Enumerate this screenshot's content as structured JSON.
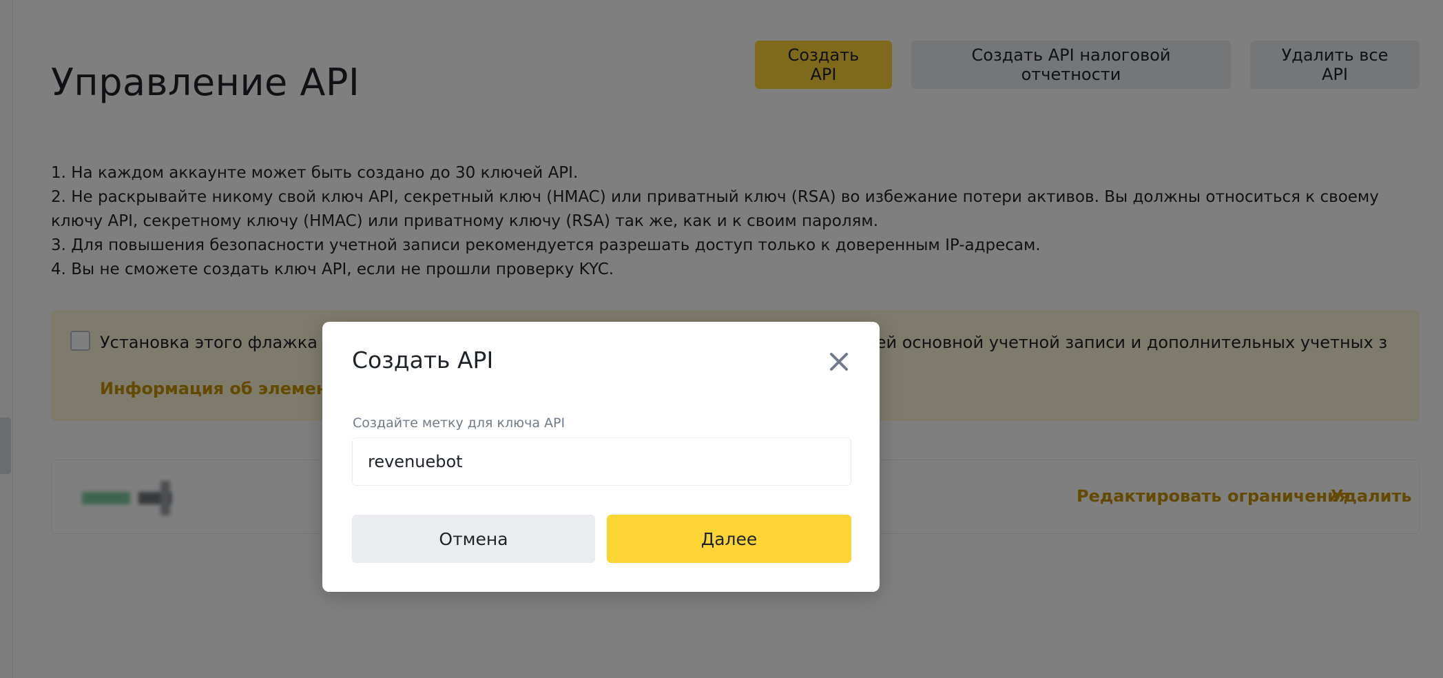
{
  "header": {
    "title": "Управление API",
    "buttons": {
      "create": "Создать API",
      "tax": "Создать API налоговой отчетности",
      "delete_all": "Удалить все API"
    }
  },
  "rules": [
    "1. На каждом аккаунте может быть создано до 30 ключей API.",
    "2. Не раскрывайте никому свой ключ API, секретный ключ (HMAC) или приватный ключ (RSA) во избежание потери активов. Вы должны относиться к своему ключу API, секретному ключу (HMAC) или приватному ключу (RSA) так же, как и к своим паролям.",
    "3. Для повышения безопасности учетной записи рекомендуется разрешать доступ только к доверенным IP-адресам.",
    "4. Вы не сможете создать ключ API, если не прошли проверку KYC."
  ],
  "notice": {
    "text": "Установка этого флажка ак                                                                        сех ключей в вашей основной учетной записи и дополнительных учетных з",
    "link": "Информация об элементах"
  },
  "key_card": {
    "edit_label": "Редактировать ограничения",
    "delete_label": "Удалить"
  },
  "modal": {
    "title": "Создать API",
    "field_label": "Создайте метку для ключа API",
    "field_value": "revenuebot",
    "cancel": "Отмена",
    "next": "Далее"
  },
  "icons": {
    "close": "close-icon"
  },
  "colors": {
    "accent": "#fcd535",
    "link": "#c99400",
    "notice_bg": "#fdf6d8",
    "secondary_btn": "#eaecef"
  }
}
